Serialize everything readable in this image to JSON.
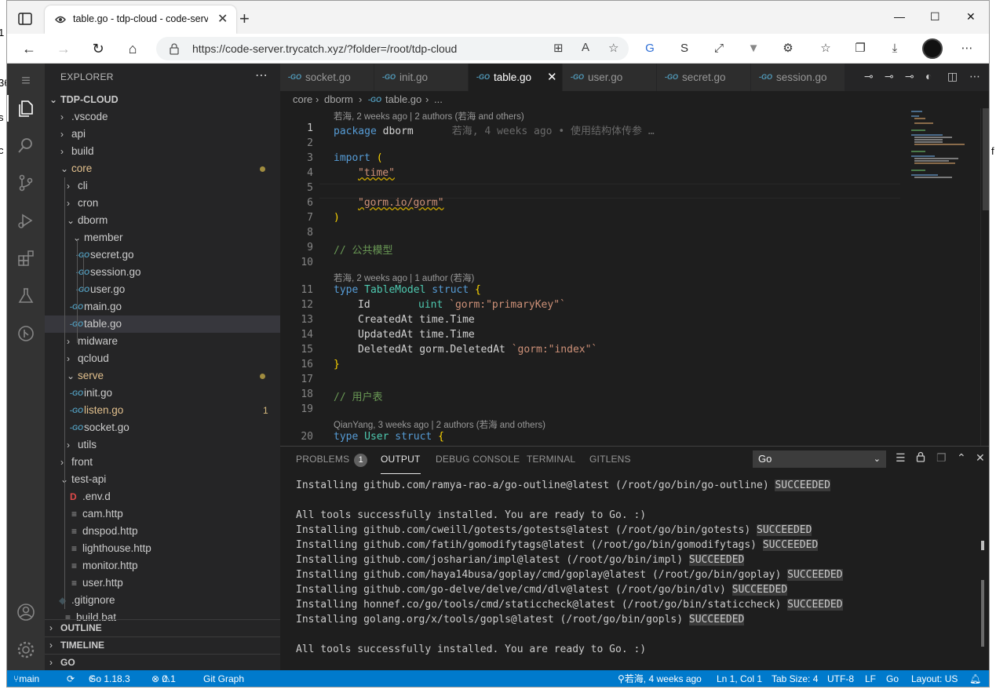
{
  "page_edge": {
    "left_fragments": [
      "1",
      "36",
      "s",
      "c"
    ],
    "right_fragment": "f"
  },
  "browser": {
    "tab_title": "table.go - tdp-cloud - code-server",
    "url": "https://code-server.trycatch.xyz/?folder=/root/tdp-cloud"
  },
  "sidebar": {
    "title": "EXPLORER",
    "root": "TDP-CLOUD",
    "tree": [
      {
        "label": ".vscode",
        "kind": "folder",
        "open": false,
        "depth": 1
      },
      {
        "label": "api",
        "kind": "folder",
        "open": false,
        "depth": 1
      },
      {
        "label": "build",
        "kind": "folder",
        "open": false,
        "depth": 1
      },
      {
        "label": "core",
        "kind": "folder",
        "open": true,
        "depth": 1,
        "modified": true
      },
      {
        "label": "cli",
        "kind": "folder",
        "open": false,
        "depth": 2
      },
      {
        "label": "cron",
        "kind": "folder",
        "open": false,
        "depth": 2
      },
      {
        "label": "dborm",
        "kind": "folder",
        "open": true,
        "depth": 2
      },
      {
        "label": "member",
        "kind": "folder",
        "open": true,
        "depth": 3
      },
      {
        "label": "secret.go",
        "kind": "go",
        "depth": 4
      },
      {
        "label": "session.go",
        "kind": "go",
        "depth": 4
      },
      {
        "label": "user.go",
        "kind": "go",
        "depth": 4
      },
      {
        "label": "main.go",
        "kind": "go",
        "depth": 3
      },
      {
        "label": "table.go",
        "kind": "go",
        "depth": 3,
        "selected": true
      },
      {
        "label": "midware",
        "kind": "folder",
        "open": false,
        "depth": 2
      },
      {
        "label": "qcloud",
        "kind": "folder",
        "open": false,
        "depth": 2
      },
      {
        "label": "serve",
        "kind": "folder",
        "open": true,
        "depth": 2,
        "modified": true
      },
      {
        "label": "init.go",
        "kind": "go",
        "depth": 3
      },
      {
        "label": "listen.go",
        "kind": "go",
        "depth": 3,
        "modified": true,
        "count": "1"
      },
      {
        "label": "socket.go",
        "kind": "go",
        "depth": 3
      },
      {
        "label": "utils",
        "kind": "folder",
        "open": false,
        "depth": 2
      },
      {
        "label": "front",
        "kind": "folder",
        "open": false,
        "depth": 1
      },
      {
        "label": "test-api",
        "kind": "folder",
        "open": true,
        "depth": 1
      },
      {
        "label": ".env.d",
        "kind": "d",
        "depth": 2
      },
      {
        "label": "cam.http",
        "kind": "file",
        "depth": 2
      },
      {
        "label": "dnspod.http",
        "kind": "file",
        "depth": 2
      },
      {
        "label": "lighthouse.http",
        "kind": "file",
        "depth": 2
      },
      {
        "label": "monitor.http",
        "kind": "file",
        "depth": 2
      },
      {
        "label": "user.http",
        "kind": "file",
        "depth": 2
      },
      {
        "label": ".gitignore",
        "kind": "git",
        "depth": 1
      },
      {
        "label": "build.bat",
        "kind": "file",
        "depth": 1
      }
    ],
    "sections": [
      "OUTLINE",
      "TIMELINE",
      "GO"
    ]
  },
  "editor": {
    "tabs": [
      "socket.go",
      "init.go",
      "table.go",
      "user.go",
      "secret.go",
      "session.go"
    ],
    "active_tab": 2,
    "breadcrumb": [
      "core",
      "dborm",
      "table.go",
      "..."
    ],
    "lens": [
      "若海, 2 weeks ago | 2 authors (若海 and others)",
      "若海, 2 weeks ago | 1 author (若海)",
      "QianYang, 3 weeks ago | 2 authors (若海 and others)"
    ],
    "blame": "若海, 4 weeks ago • 使用结构体传参 …",
    "line_numbers": [
      "1",
      "2",
      "3",
      "4",
      "5",
      "6",
      "7",
      "8",
      "9",
      "10",
      "11",
      "12",
      "13",
      "14",
      "15",
      "16",
      "17",
      "18",
      "19",
      "20"
    ],
    "code": {
      "l1_kw": "package",
      "l1_id": " dborm",
      "l3_kw": "import",
      "l3_p": " (",
      "l4": "\"time\"",
      "l6": "\"gorm.io/gorm\"",
      "l7": ")",
      "l9": "// 公共模型",
      "l11_kw": "type",
      "l11_t": " TableModel",
      "l11_kw2": " struct",
      "l11_p": " {",
      "l12_f": "Id",
      "l12_t": "uint",
      "l12_tag": "`gorm:\"primaryKey\"`",
      "l13_f": "CreatedAt",
      "l13_t": "time.Time",
      "l14_f": "UpdatedAt",
      "l14_t": "time.Time",
      "l15_f": "DeletedAt",
      "l15_t": "gorm.DeletedAt",
      "l15_tag": "`gorm:\"index\"`",
      "l16": "}",
      "l18": "// 用户表",
      "l20_kw": "type",
      "l20_t": " User",
      "l20_kw2": " struct",
      "l20_p": " {"
    }
  },
  "panel": {
    "tabs": [
      "PROBLEMS",
      "OUTPUT",
      "DEBUG CONSOLE",
      "TERMINAL",
      "GITLENS"
    ],
    "problems_count": "1",
    "active_tab": "OUTPUT",
    "channel": "Go",
    "lines": [
      {
        "text": "Installing github.com/ramya-rao-a/go-outline@latest (/root/go/bin/go-outline) ",
        "status": "SUCCEEDED"
      },
      {
        "text": "",
        "status": ""
      },
      {
        "text": "All tools successfully installed. You are ready to Go. :)",
        "status": ""
      },
      {
        "text": "Installing github.com/cweill/gotests/gotests@latest (/root/go/bin/gotests) ",
        "status": "SUCCEEDED"
      },
      {
        "text": "Installing github.com/fatih/gomodifytags@latest (/root/go/bin/gomodifytags) ",
        "status": "SUCCEEDED"
      },
      {
        "text": "Installing github.com/josharian/impl@latest (/root/go/bin/impl) ",
        "status": "SUCCEEDED"
      },
      {
        "text": "Installing github.com/haya14busa/goplay/cmd/goplay@latest (/root/go/bin/goplay) ",
        "status": "SUCCEEDED"
      },
      {
        "text": "Installing github.com/go-delve/delve/cmd/dlv@latest (/root/go/bin/dlv) ",
        "status": "SUCCEEDED"
      },
      {
        "text": "Installing honnef.co/go/tools/cmd/staticcheck@latest (/root/go/bin/staticcheck) ",
        "status": "SUCCEEDED"
      },
      {
        "text": "Installing golang.org/x/tools/gopls@latest (/root/go/bin/gopls) ",
        "status": "SUCCEEDED"
      },
      {
        "text": "",
        "status": ""
      },
      {
        "text": "All tools successfully installed. You are ready to Go. :)",
        "status": ""
      }
    ]
  },
  "statusbar": {
    "branch": "main",
    "go_version": "Go 1.18.3",
    "errors": "0",
    "warnings": "1",
    "git_graph": "Git Graph",
    "blame": "若海, 4 weeks ago",
    "position": "Ln 1, Col 1",
    "tab_size": "Tab Size: 4",
    "encoding": "UTF-8",
    "eol": "LF",
    "language": "Go",
    "layout": "Layout: US"
  }
}
